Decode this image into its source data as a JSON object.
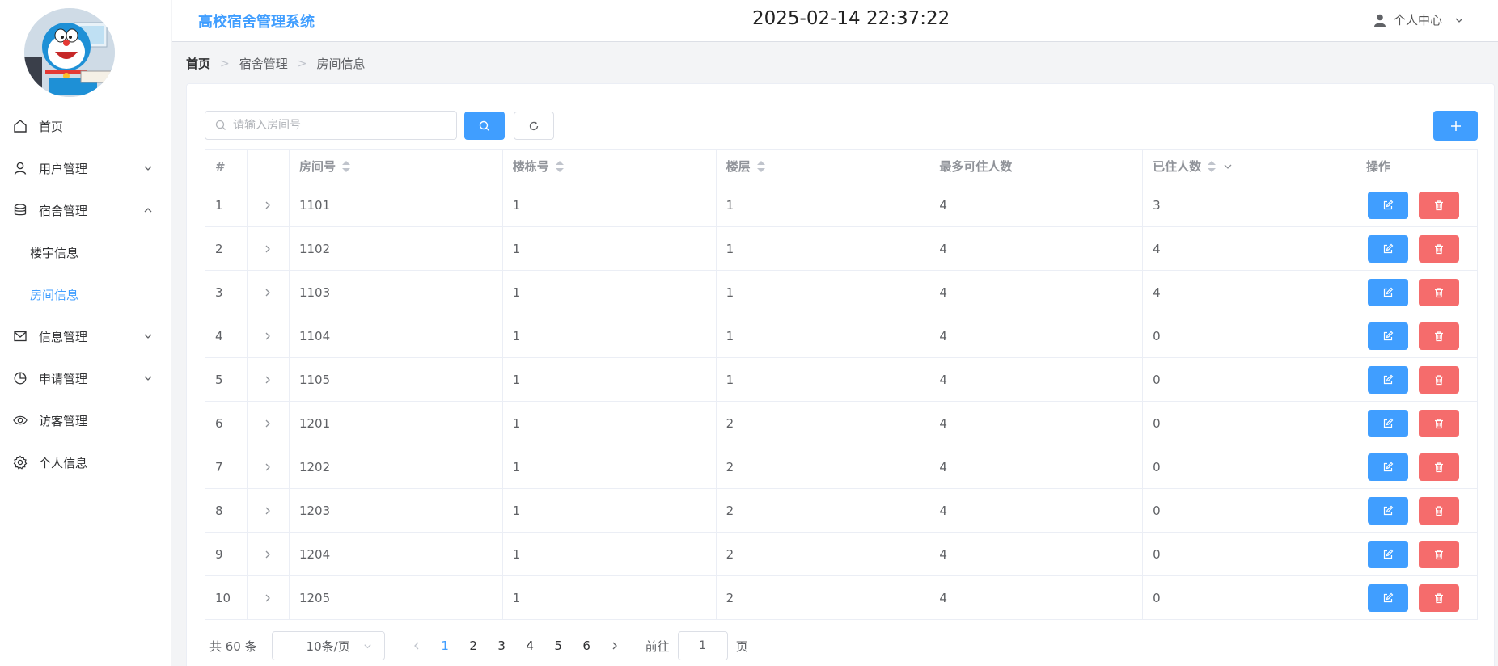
{
  "header": {
    "app_title": "高校宿舍管理系统",
    "datetime": "2025-02-14 22:37:22",
    "user_center": "个人中心"
  },
  "sidebar": {
    "items": [
      {
        "label": "首页",
        "icon": "home-icon"
      },
      {
        "label": "用户管理",
        "icon": "user-icon",
        "chevron": "down"
      },
      {
        "label": "宿舍管理",
        "icon": "database-icon",
        "chevron": "up"
      },
      {
        "label": "信息管理",
        "icon": "message-icon",
        "chevron": "down"
      },
      {
        "label": "申请管理",
        "icon": "pie-chart-icon",
        "chevron": "down"
      },
      {
        "label": "访客管理",
        "icon": "eye-icon"
      },
      {
        "label": "个人信息",
        "icon": "gear-icon"
      }
    ],
    "submenu": [
      {
        "label": "楼宇信息",
        "active": false
      },
      {
        "label": "房间信息",
        "active": true
      }
    ]
  },
  "breadcrumb": [
    "首页",
    "宿舍管理",
    "房间信息"
  ],
  "toolbar": {
    "search_placeholder": "请输入房间号",
    "search_value": ""
  },
  "table": {
    "columns": [
      "#",
      "",
      "房间号",
      "楼栋号",
      "楼层",
      "最多可住人数",
      "已住人数",
      "操作"
    ],
    "rows": [
      {
        "index": "1",
        "room": "1101",
        "building": "1",
        "floor": "1",
        "max": "4",
        "occupied": "3"
      },
      {
        "index": "2",
        "room": "1102",
        "building": "1",
        "floor": "1",
        "max": "4",
        "occupied": "4"
      },
      {
        "index": "3",
        "room": "1103",
        "building": "1",
        "floor": "1",
        "max": "4",
        "occupied": "4"
      },
      {
        "index": "4",
        "room": "1104",
        "building": "1",
        "floor": "1",
        "max": "4",
        "occupied": "0"
      },
      {
        "index": "5",
        "room": "1105",
        "building": "1",
        "floor": "1",
        "max": "4",
        "occupied": "0"
      },
      {
        "index": "6",
        "room": "1201",
        "building": "1",
        "floor": "2",
        "max": "4",
        "occupied": "0"
      },
      {
        "index": "7",
        "room": "1202",
        "building": "1",
        "floor": "2",
        "max": "4",
        "occupied": "0"
      },
      {
        "index": "8",
        "room": "1203",
        "building": "1",
        "floor": "2",
        "max": "4",
        "occupied": "0"
      },
      {
        "index": "9",
        "room": "1204",
        "building": "1",
        "floor": "2",
        "max": "4",
        "occupied": "0"
      },
      {
        "index": "10",
        "room": "1205",
        "building": "1",
        "floor": "2",
        "max": "4",
        "occupied": "0"
      }
    ]
  },
  "pagination": {
    "total": "共 60 条",
    "page_size": "10条/页",
    "pages": [
      "1",
      "2",
      "3",
      "4",
      "5",
      "6"
    ],
    "current_page": "1",
    "goto_label": "前往",
    "goto_value": "1",
    "page_suffix": "页"
  },
  "colors": {
    "primary": "#409eff",
    "danger": "#f56c6c"
  }
}
